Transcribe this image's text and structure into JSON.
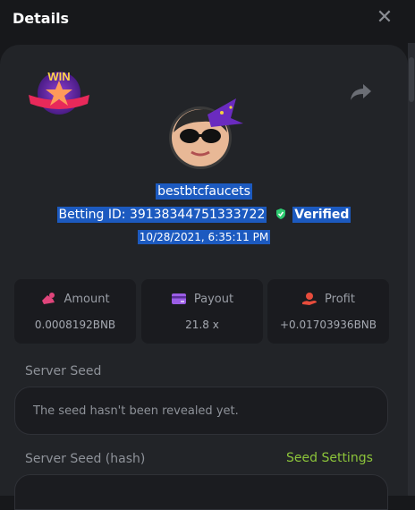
{
  "header": {
    "title": "Details",
    "close_icon": "close-icon"
  },
  "profile": {
    "username": "bestbtcfaucets",
    "betting_id_label": "Betting ID:",
    "betting_id": "391383447513337​22",
    "verified_label": "Verified",
    "date": "10/28/2021, 6:35:11 PM",
    "badge_text": "WIN"
  },
  "stats": {
    "amount": {
      "label": "Amount",
      "value": "0.0008192BNB",
      "icon": "amount-icon",
      "color": "#e0457b"
    },
    "payout": {
      "label": "Payout",
      "value": "21.8 x",
      "icon": "payout-icon",
      "color": "#9b5de5"
    },
    "profit": {
      "label": "Profit",
      "value": "+0.01703936BNB",
      "icon": "profit-icon",
      "color": "#e74c3c"
    }
  },
  "server_seed": {
    "label": "Server Seed",
    "text": "The seed hasn't been revealed yet."
  },
  "server_seed_hash": {
    "label": "Server Seed (hash)",
    "settings_link": "Seed Settings",
    "text": ""
  },
  "colors": {
    "accent_green": "#8cc43a",
    "selection_blue": "#1c5ac0",
    "panel": "#222428"
  }
}
